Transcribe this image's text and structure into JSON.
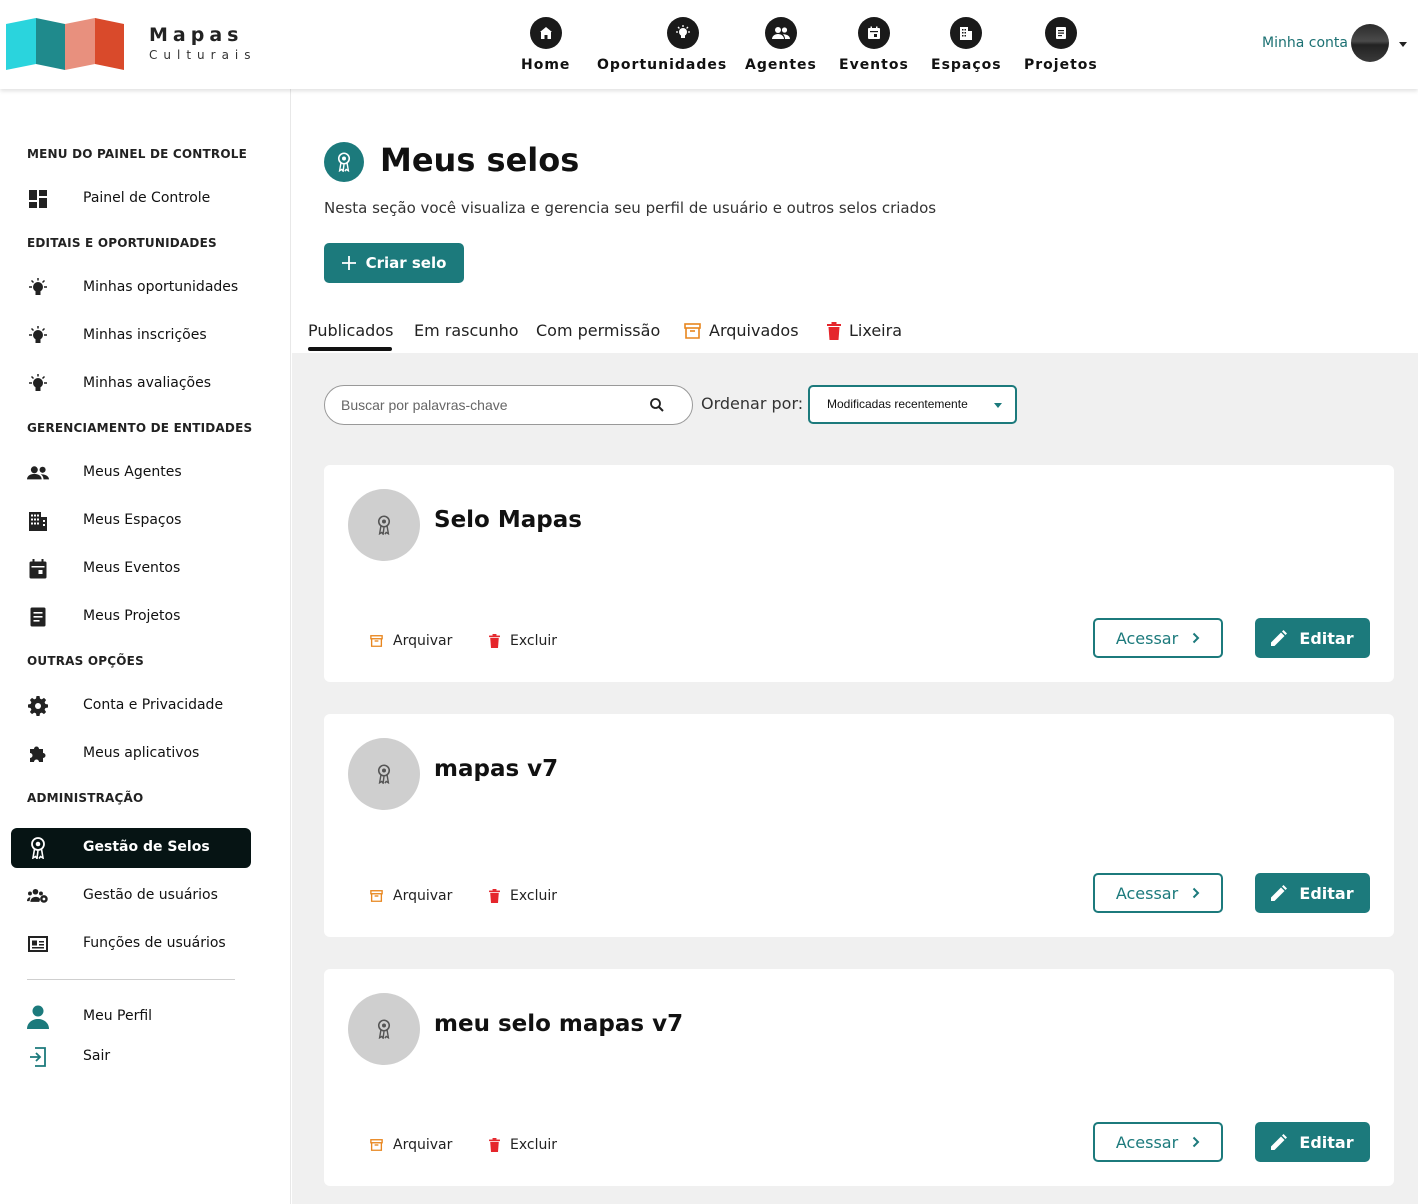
{
  "brand": {
    "name": "Mapas",
    "sub": "Culturais",
    "colors": [
      "#2ad4dd",
      "#1f8a8c",
      "#e8907e",
      "#d94a2b"
    ]
  },
  "nav": [
    {
      "label": "Home",
      "icon": "home-icon"
    },
    {
      "label": "Oportunidades",
      "icon": "lightbulb-icon"
    },
    {
      "label": "Agentes",
      "icon": "people-icon"
    },
    {
      "label": "Eventos",
      "icon": "calendar-icon"
    },
    {
      "label": "Espaços",
      "icon": "building-icon"
    },
    {
      "label": "Projetos",
      "icon": "document-icon"
    }
  ],
  "account": {
    "label": "Minha conta"
  },
  "sidebar": {
    "sections": [
      "MENU DO PAINEL DE CONTROLE",
      "EDITAIS E OPORTUNIDADES",
      "GERENCIAMENTO DE ENTIDADES",
      "OUTRAS OPÇÕES",
      "ADMINISTRAÇÃO"
    ],
    "items": [
      {
        "label": "Painel de Controle",
        "icon": "dashboard-icon"
      },
      {
        "label": "Minhas oportunidades",
        "icon": "lightbulb-icon"
      },
      {
        "label": "Minhas inscrições",
        "icon": "lightbulb-icon"
      },
      {
        "label": "Minhas avaliações",
        "icon": "lightbulb-icon"
      },
      {
        "label": "Meus Agentes",
        "icon": "people-icon"
      },
      {
        "label": "Meus Espaços",
        "icon": "building-icon"
      },
      {
        "label": "Meus Eventos",
        "icon": "calendar-icon"
      },
      {
        "label": "Meus Projetos",
        "icon": "document-icon"
      },
      {
        "label": "Conta e Privacidade",
        "icon": "gear-icon"
      },
      {
        "label": "Meus aplicativos",
        "icon": "puzzle-icon"
      },
      {
        "label": "Gestão de Selos",
        "icon": "seal-icon",
        "active": true
      },
      {
        "label": "Gestão de usuários",
        "icon": "users-gear-icon"
      },
      {
        "label": "Funções de usuários",
        "icon": "id-card-icon"
      },
      {
        "label": "Meu Perfil",
        "icon": "person-icon"
      },
      {
        "label": "Sair",
        "icon": "logout-icon"
      }
    ]
  },
  "page": {
    "title": "Meus selos",
    "subtitle": "Nesta seção você visualiza e gerencia seu perfil de usuário e outros selos criados",
    "create_label": "Criar selo"
  },
  "tabs": [
    {
      "label": "Publicados",
      "active": true
    },
    {
      "label": "Em rascunho"
    },
    {
      "label": "Com permissão"
    },
    {
      "label": "Arquivados",
      "icon": "archive-icon"
    },
    {
      "label": "Lixeira",
      "icon": "trash-icon"
    }
  ],
  "filters": {
    "search_placeholder": "Buscar por palavras-chave",
    "order_label": "Ordenar por:",
    "order_value": "Modificadas recentemente"
  },
  "cards": [
    {
      "name": "Selo Mapas"
    },
    {
      "name": "mapas v7"
    },
    {
      "name": "meu selo mapas v7"
    }
  ],
  "card_actions": {
    "archive": "Arquivar",
    "delete": "Excluir",
    "access": "Acessar",
    "edit": "Editar"
  },
  "accent": "#1c7a7c"
}
